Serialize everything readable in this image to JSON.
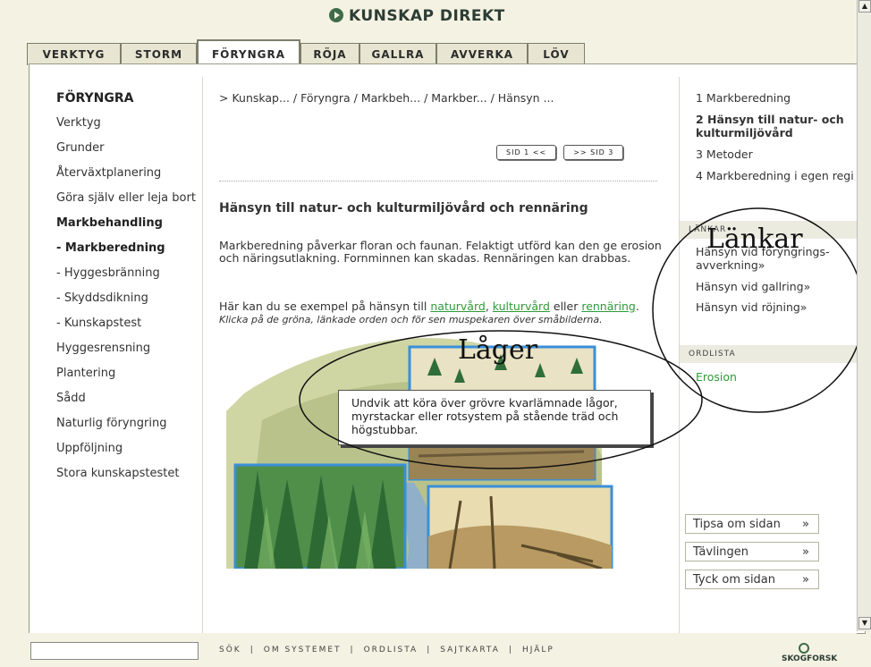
{
  "app_title": "KUNSKAP DIREKT",
  "tabs": [
    {
      "label": "VERKTYG",
      "active": false
    },
    {
      "label": "STORM",
      "active": false
    },
    {
      "label": "FÖRYNGRA",
      "active": true
    },
    {
      "label": "RÖJA",
      "active": false
    },
    {
      "label": "GALLRA",
      "active": false
    },
    {
      "label": "AVVERKA",
      "active": false
    },
    {
      "label": "LÖV",
      "active": false
    }
  ],
  "left_nav": {
    "title": "FÖRYNGRA",
    "items": [
      {
        "label": "Verktyg"
      },
      {
        "label": "Grunder"
      },
      {
        "label": "Återväxtplanering"
      },
      {
        "label": "Göra själv eller leja bort"
      },
      {
        "label": "Markbehandling"
      },
      {
        "label": "- Markberedning"
      },
      {
        "label": "- Hyggesbränning"
      },
      {
        "label": "- Skyddsdikning"
      },
      {
        "label": "- Kunskapstest"
      },
      {
        "label": "Hyggesrensning"
      },
      {
        "label": "Plantering"
      },
      {
        "label": "Sådd"
      },
      {
        "label": "Naturlig föryngring"
      },
      {
        "label": "Uppföljning"
      },
      {
        "label": "Stora kunskapstestet"
      }
    ]
  },
  "breadcrumb": "> Kunskap... / Föryngra / Markbeh... / Markber... / Hänsyn ...",
  "pager": {
    "prev": "SID 1 <<",
    "next": ">> SID 3"
  },
  "content": {
    "heading": "Hänsyn till natur- och kulturmiljövård och rennäring",
    "paragraph": "Markberedning påverkar floran och faunan. Felaktigt utförd kan den ge erosion och näringsutlakning. Fornminnen kan skadas. Rennäringen kan drabbas.",
    "para2_intro": "Här kan du se exempel på hänsyn till ",
    "link_naturvard": "naturvård",
    "comma": ", ",
    "link_kulturvard": "kulturvård",
    "eller": " eller ",
    "link_rennaring": "rennäring",
    "period": ". ",
    "hint": "Klicka på de gröna, länkade orden och för sen muspekaren över småbilderna."
  },
  "tooltip": "Undvik att köra över grövre kvarlämnade lågor, myrstackar eller rotsystem på stående träd och högstubbar.",
  "annotations": {
    "lager": "Låger",
    "lankar": "Länkar"
  },
  "right_steps": [
    {
      "label": "1 Markberedning"
    },
    {
      "label": "2 Hänsyn till natur- och kulturmiljövård"
    },
    {
      "label": "3 Metoder"
    },
    {
      "label": "4 Markberedning i egen regi"
    }
  ],
  "links_section": {
    "header": "LÄNKAR",
    "items": [
      {
        "label": "Hänsyn vid föryngrings-avverkning»"
      },
      {
        "label": "Hänsyn vid gallring»"
      },
      {
        "label": "Hänsyn vid röjning»"
      }
    ]
  },
  "ordlista": {
    "header": "ORDLISTA",
    "item": "Erosion"
  },
  "side_buttons": [
    {
      "label": "Tipsa om sidan",
      "arrow": "»"
    },
    {
      "label": "Tävlingen",
      "arrow": "»"
    },
    {
      "label": "Tyck om sidan",
      "arrow": "»"
    }
  ],
  "footer": {
    "links": [
      "SÖK",
      "OM SYSTEMET",
      "ORDLISTA",
      "SAJTKARTA",
      "HJÄLP"
    ],
    "separator": "|",
    "logo": "SKOGFORSK"
  },
  "colors": {
    "accent_green": "#2e9a3a",
    "frame": "#f4f2e2",
    "picture_border": "#3a8fd8"
  }
}
